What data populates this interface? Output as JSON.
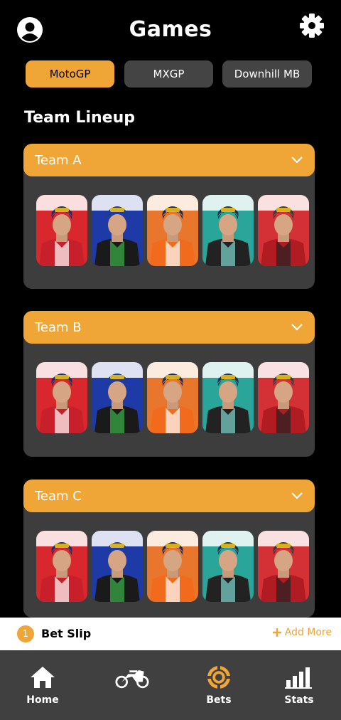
{
  "header": {
    "title": "Games"
  },
  "tabs": [
    {
      "label": "MotoGP",
      "active": true
    },
    {
      "label": "MXGP",
      "active": false
    },
    {
      "label": "Downhill MB",
      "active": false
    }
  ],
  "section_title": "Team Lineup",
  "teams": [
    {
      "name": "Team A",
      "riders": [
        "ducati",
        "yamaha",
        "repsol",
        "petronas",
        "lcr"
      ]
    },
    {
      "name": "Team B",
      "riders": [
        "ducati",
        "yamaha",
        "repsol",
        "petronas",
        "lcr"
      ]
    },
    {
      "name": "Team C",
      "riders": [
        "ducati",
        "yamaha",
        "repsol",
        "petronas",
        "lcr"
      ]
    }
  ],
  "bet_slip": {
    "count": "1",
    "label": "Bet Slip",
    "add_more": "Add More"
  },
  "nav": [
    {
      "label": "Home",
      "icon": "home-icon",
      "active": false
    },
    {
      "label": "",
      "icon": "motorcycle-icon",
      "active": false
    },
    {
      "label": "Bets",
      "icon": "poker-chip-icon",
      "active": true
    },
    {
      "label": "Stats",
      "icon": "bar-chart-icon",
      "active": false
    }
  ],
  "colors": {
    "accent": "#F0A537",
    "card": "#3d3d3d",
    "nav": "#404040"
  }
}
